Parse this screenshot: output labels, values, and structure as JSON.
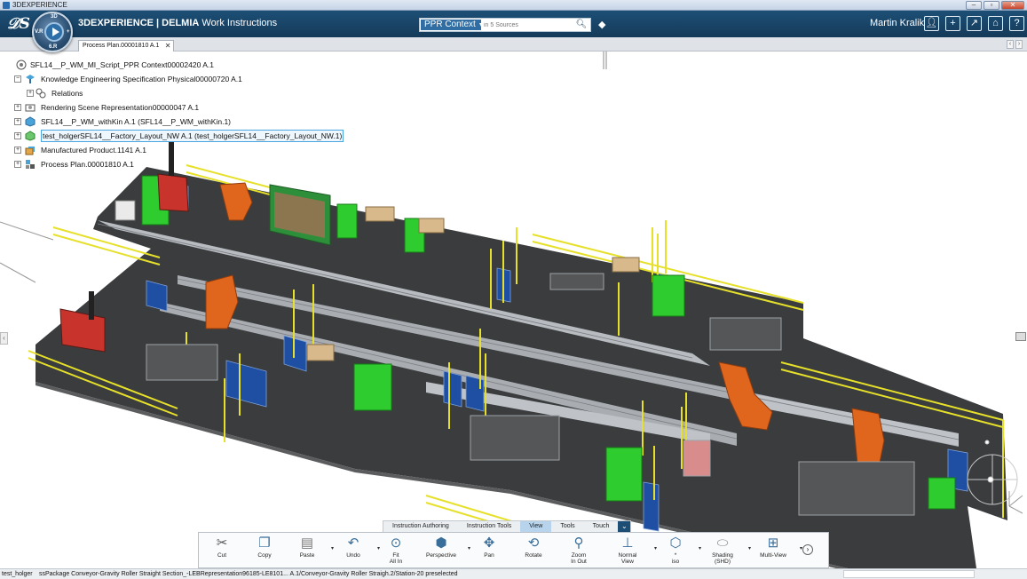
{
  "window": {
    "title": "3DEXPERIENCE"
  },
  "header": {
    "brand": "3DEXPERIENCE | ",
    "product": "DELMIA",
    "app_name": " Work Instructions",
    "compass_labels": {
      "n": "3D",
      "w": "V.R",
      "e": "+",
      "s": "6.R"
    },
    "search": {
      "context_label": "PPR Context",
      "placeholder": "in 5 Sources"
    },
    "user": "Martin Kralik"
  },
  "tabs": {
    "active_label": "Process Plan.00001810 A.1"
  },
  "tree": {
    "items": [
      {
        "label": "SFL14__P_WM_MI_Script_PPR Context00002420 A.1",
        "icon": "ppr-context-icon"
      },
      {
        "label": "Knowledge Engineering Specification Physical00000720 A.1",
        "icon": "knowledge-icon",
        "expander": "−"
      },
      {
        "label": "Relations",
        "icon": "relations-icon",
        "expander": "+"
      },
      {
        "label": "Rendering Scene Representation00000047 A.1",
        "icon": "rendering-icon",
        "expander": "+"
      },
      {
        "label": "SFL14__P_WM_withKin A.1 (SFL14__P_WM_withKin.1)",
        "icon": "product-icon",
        "expander": "+"
      },
      {
        "label": "test_holgerSFL14__Factory_Layout_NW A.1 (test_holgerSFL14__Factory_Layout_NW.1)",
        "icon": "layout-icon",
        "expander": "+"
      },
      {
        "label": "Manufactured Product.1141 A.1",
        "icon": "manufactured-product-icon",
        "expander": "+"
      },
      {
        "label": "Process Plan.00001810 A.1",
        "icon": "process-plan-icon",
        "expander": "+"
      }
    ]
  },
  "action_bar": {
    "tabs": [
      "Instruction Authoring",
      "Instruction Tools",
      "View",
      "Tools",
      "Touch"
    ],
    "active_tab": "View",
    "buttons": [
      {
        "label": "Cut",
        "icon": "scissors-icon"
      },
      {
        "label": "Copy",
        "icon": "copy-icon"
      },
      {
        "label": "Paste",
        "icon": "paste-icon"
      },
      {
        "label": "Undo",
        "icon": "undo-icon"
      },
      {
        "label": "Fit\nAll In",
        "icon": "fit-all-icon"
      },
      {
        "label": "Perspective",
        "icon": "perspective-icon"
      },
      {
        "label": "Pan",
        "icon": "pan-icon"
      },
      {
        "label": "Rotate",
        "icon": "rotate-icon"
      },
      {
        "label": "Zoom\nIn Out",
        "icon": "zoom-icon"
      },
      {
        "label": "Normal\nView",
        "icon": "normal-view-icon"
      },
      {
        "label": "*\niso",
        "icon": "iso-icon"
      },
      {
        "label": "Shading\n(SHD)",
        "icon": "shading-icon"
      },
      {
        "label": "Multi-View",
        "icon": "multi-view-icon"
      }
    ]
  },
  "status_bar": {
    "user": "test_holger",
    "message": "ssPackage Conveyor-Gravity Roller Straight Section_-LEBRepresentation96185-LE8101... A.1/Conveyor-Gravity Roller Straigh.2/Station-20 preselected"
  },
  "colors": {
    "header_bg": "#1d4f76",
    "floor": "#3a3c3e",
    "railing": "#e6e02a",
    "robot": "#e0661e",
    "rack_green": "#2ecc2e",
    "guard_blue": "#1f4fa3",
    "conveyor": "#a9adb2"
  }
}
